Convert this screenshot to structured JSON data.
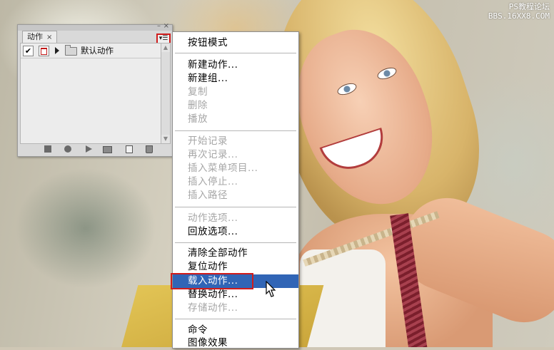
{
  "watermark": {
    "line1": "PS教程论坛",
    "line2": "BBS.16XX8.COM"
  },
  "panel": {
    "tab_label": "动作",
    "tab_close_icon": "×",
    "minimize_icon": "–",
    "close_icon": "×",
    "menu_button_icon": "▾☰",
    "actions": [
      {
        "label": "默认动作",
        "checked": true,
        "expanded": false
      }
    ],
    "toolbar": [
      "stop-icon",
      "record-icon",
      "play-icon",
      "new-set-icon",
      "new-action-icon",
      "trash-icon"
    ]
  },
  "menu": {
    "items": [
      {
        "label": "按钮模式",
        "disabled": false
      },
      {
        "label": "新建动作...",
        "disabled": false
      },
      {
        "label": "新建组...",
        "disabled": false
      },
      {
        "label": "复制",
        "disabled": true
      },
      {
        "label": "删除",
        "disabled": true
      },
      {
        "label": "播放",
        "disabled": true
      },
      {
        "label": "开始记录",
        "disabled": true
      },
      {
        "label": "再次记录...",
        "disabled": true
      },
      {
        "label": "插入菜单项目...",
        "disabled": true
      },
      {
        "label": "插入停止...",
        "disabled": true
      },
      {
        "label": "插入路径",
        "disabled": true
      },
      {
        "label": "动作选项...",
        "disabled": true
      },
      {
        "label": "回放选项...",
        "disabled": false
      },
      {
        "label": "清除全部动作",
        "disabled": false
      },
      {
        "label": "复位动作",
        "disabled": false
      },
      {
        "label": "载入动作...",
        "disabled": false,
        "highlighted": true
      },
      {
        "label": "替换动作...",
        "disabled": false
      },
      {
        "label": "存储动作...",
        "disabled": true
      },
      {
        "label": "命令",
        "disabled": false
      },
      {
        "label": "图像效果",
        "disabled": false
      }
    ]
  },
  "colors": {
    "highlight": "#3165b6",
    "annotation_red": "#d01c1c",
    "disabled_text": "#a6a6a6"
  }
}
